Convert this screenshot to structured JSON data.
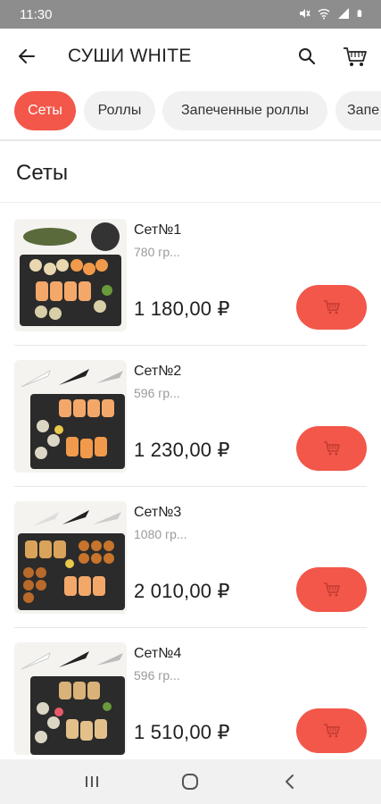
{
  "status_bar": {
    "time": "11:30",
    "icons": [
      "mute-icon",
      "wifi-icon",
      "signal-icon",
      "battery-icon"
    ]
  },
  "app_bar": {
    "title": "СУШИ WHITE",
    "back_icon": "arrow-left-icon",
    "search_icon": "search-icon",
    "cart_icon": "cart-icon"
  },
  "tabs": [
    {
      "label": "Сеты",
      "active": true
    },
    {
      "label": "Роллы",
      "active": false
    },
    {
      "label": "Запеченные роллы",
      "active": false
    },
    {
      "label": "Запе",
      "active": false
    }
  ],
  "section": {
    "title": "Сеты"
  },
  "products": [
    {
      "name": "Сет№1",
      "weight": "780 гр...",
      "price": "1 180,00 ₽"
    },
    {
      "name": "Сет№2",
      "weight": "596 гр...",
      "price": "1 230,00 ₽"
    },
    {
      "name": "Сет№3",
      "weight": "1080 гр...",
      "price": "2 010,00 ₽"
    },
    {
      "name": "Сет№4",
      "weight": "596 гр...",
      "price": "1 510,00 ₽"
    }
  ],
  "nav_bar": {
    "icons": [
      "recent-apps-icon",
      "home-icon",
      "back-icon"
    ]
  },
  "colors": {
    "accent": "#f2574a",
    "status_bar": "#8d8d8d",
    "chip_bg": "#f1f1f1",
    "muted_text": "#9a9a9a"
  }
}
